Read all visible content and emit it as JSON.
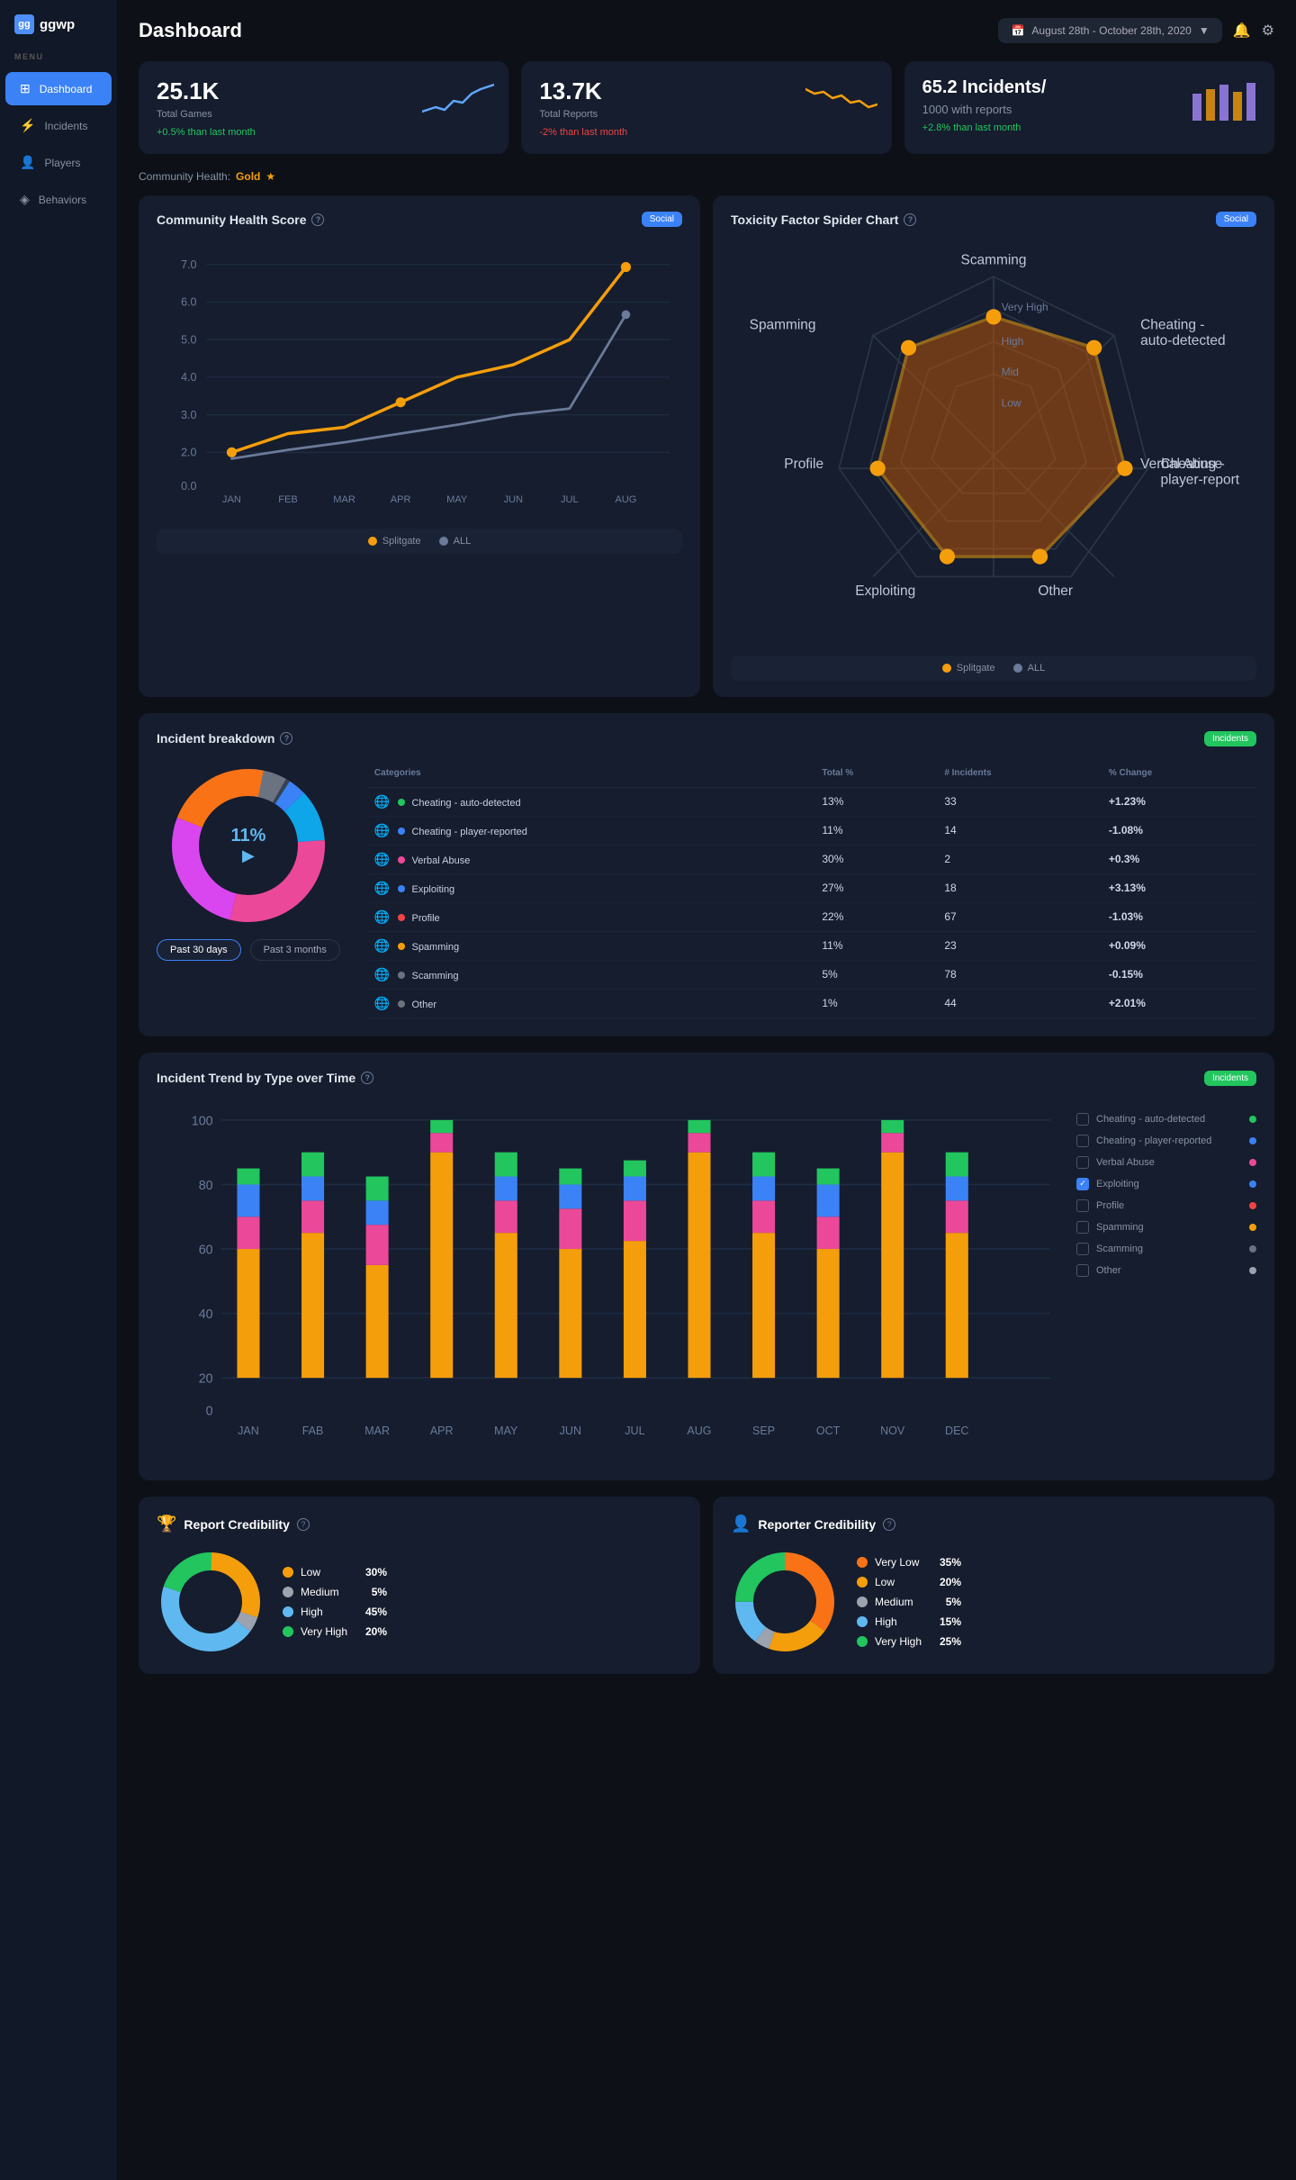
{
  "logo": {
    "text": "ggwp"
  },
  "menu": {
    "label": "MENU",
    "items": [
      {
        "id": "dashboard",
        "label": "Dashboard",
        "icon": "⊞",
        "active": true
      },
      {
        "id": "incidents",
        "label": "Incidents",
        "icon": "⚡",
        "active": false
      },
      {
        "id": "players",
        "label": "Players",
        "icon": "👤",
        "active": false
      },
      {
        "id": "behaviors",
        "label": "Behaviors",
        "icon": "◈",
        "active": false
      }
    ]
  },
  "header": {
    "title": "Dashboard",
    "date_range": "August 28th - October 28th, 2020"
  },
  "stats": [
    {
      "value": "25.1K",
      "label": "Total Games",
      "change": "+0.5%",
      "change_text": " than last month",
      "positive": true,
      "color": "#60a5fa"
    },
    {
      "value": "13.7K",
      "label": "Total Reports",
      "change": "-2%",
      "change_text": " than last month",
      "positive": false,
      "color": "#f59e0b"
    },
    {
      "value": "65.2 Incidents/ 1000 with reports",
      "label": "",
      "change": "+2.8%",
      "change_text": " than last month",
      "positive": true,
      "color": "#a78bfa"
    }
  ],
  "community_health": {
    "label": "Community Health:",
    "rating": "Gold",
    "star": "★"
  },
  "health_score": {
    "title": "Community Health Score",
    "badge": "Social",
    "legend": [
      {
        "label": "Splitgate",
        "color": "#f59e0b"
      },
      {
        "label": "ALL",
        "color": "#6b7a99"
      }
    ]
  },
  "toxicity_chart": {
    "title": "Toxicity Factor Spider Chart",
    "badge": "Social",
    "labels": [
      "Scamming",
      "Cheating - auto-detected",
      "Cheating - player-report",
      "Verbal Abuse",
      "Other",
      "Exploiting",
      "Profile",
      "Spamming"
    ],
    "levels": [
      "Very High",
      "High",
      "Mid",
      "Low"
    ],
    "legend": [
      {
        "label": "Splitgate",
        "color": "#f59e0b"
      },
      {
        "label": "ALL",
        "color": "#6b7a99"
      }
    ]
  },
  "incident_breakdown": {
    "title": "Incident breakdown",
    "badge": "Incidents",
    "donut_center_pct": "11%",
    "time_buttons": [
      "Past 30 days",
      "Past 3 months"
    ],
    "active_time": 0,
    "table": {
      "columns": [
        "Categories",
        "Total %",
        "# Incidents",
        "% Change"
      ],
      "rows": [
        {
          "name": "Cheating - auto-detected",
          "dot_color": "#22c55e",
          "total_pct": "13%",
          "incidents": "33",
          "change": "+1.23%",
          "positive": true
        },
        {
          "name": "Cheating - player-reported",
          "dot_color": "#3b82f6",
          "total_pct": "11%",
          "incidents": "14",
          "change": "-1.08%",
          "positive": false
        },
        {
          "name": "Verbal Abuse",
          "dot_color": "#ec4899",
          "total_pct": "30%",
          "incidents": "2",
          "change": "+0.3%",
          "positive": true
        },
        {
          "name": "Exploiting",
          "dot_color": "#3b82f6",
          "total_pct": "27%",
          "incidents": "18",
          "change": "+3.13%",
          "positive": true
        },
        {
          "name": "Profile",
          "dot_color": "#ef4444",
          "total_pct": "22%",
          "incidents": "67",
          "change": "-1.03%",
          "positive": false
        },
        {
          "name": "Spamming",
          "dot_color": "#f59e0b",
          "total_pct": "11%",
          "incidents": "23",
          "change": "+0.09%",
          "positive": true
        },
        {
          "name": "Scamming",
          "dot_color": "#6b7280",
          "total_pct": "5%",
          "incidents": "78",
          "change": "-0.15%",
          "positive": false
        },
        {
          "name": "Other",
          "dot_color": "#6b7280",
          "total_pct": "1%",
          "incidents": "44",
          "change": "+2.01%",
          "positive": true
        }
      ]
    }
  },
  "trend": {
    "title": "Incident Trend by Type over Time",
    "badge": "Incidents",
    "months": [
      "JAN",
      "FAB",
      "MAR",
      "APR",
      "MAY",
      "JUN",
      "JUL",
      "AUG",
      "SEP",
      "OCT",
      "NOV",
      "DEC"
    ],
    "legend": [
      {
        "label": "Cheating - auto-detected",
        "color": "#22c55e",
        "checked": false
      },
      {
        "label": "Cheating - player-reported",
        "color": "#3b82f6",
        "checked": false
      },
      {
        "label": "Verbal Abuse",
        "color": "#ec4899",
        "checked": false
      },
      {
        "label": "Exploiting",
        "color": "#3b82f6",
        "checked": true
      },
      {
        "label": "Profile",
        "color": "#ef4444",
        "checked": false
      },
      {
        "label": "Spamming",
        "color": "#f59e0b",
        "checked": false
      },
      {
        "label": "Scamming",
        "color": "#6b7280",
        "checked": false
      },
      {
        "label": "Other",
        "color": "#9ca3af",
        "checked": false
      }
    ]
  },
  "report_credibility": {
    "title": "Report Credibility",
    "legend": [
      {
        "label": "Low",
        "color": "#f59e0b",
        "pct": "30%"
      },
      {
        "label": "Medium",
        "color": "#9ca3af",
        "pct": "5%"
      },
      {
        "label": "High",
        "color": "#60b8f0",
        "pct": "45%"
      },
      {
        "label": "Very High",
        "color": "#22c55e",
        "pct": "20%"
      }
    ]
  },
  "reporter_credibility": {
    "title": "Reporter Credibility",
    "legend": [
      {
        "label": "Very Low",
        "color": "#f97316",
        "pct": "35%"
      },
      {
        "label": "Low",
        "color": "#f59e0b",
        "pct": "20%"
      },
      {
        "label": "Medium",
        "color": "#9ca3af",
        "pct": "5%"
      },
      {
        "label": "High",
        "color": "#60b8f0",
        "pct": "15%"
      },
      {
        "label": "Very High",
        "color": "#22c55e",
        "pct": "25%"
      }
    ]
  }
}
